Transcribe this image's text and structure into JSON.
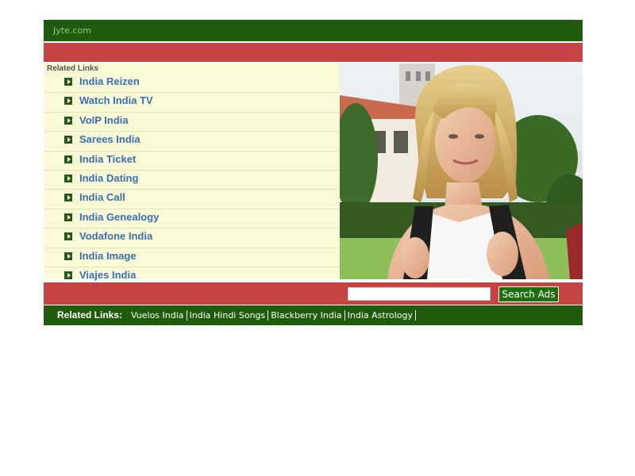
{
  "header": {
    "site_name": "Jyte.com"
  },
  "related": {
    "label": "Related Links",
    "items": [
      "India Reizen",
      "Watch India TV",
      "VoIP India",
      "Sarees India",
      "India Ticket",
      "India Dating",
      "India Call",
      "India Genealogy",
      "Vodafone India",
      "India Image",
      "Viajes India"
    ]
  },
  "search": {
    "button_label": "Search Ads",
    "value": ""
  },
  "footer": {
    "label": "Related Links:",
    "links": [
      "Vuelos India",
      "India Hindi Songs",
      "Blackberry India",
      "India Astrology"
    ]
  },
  "colors": {
    "green": "#1e5c0b",
    "red": "#c54343",
    "cream": "#fafad6",
    "link_blue": "#3a6fb5"
  }
}
